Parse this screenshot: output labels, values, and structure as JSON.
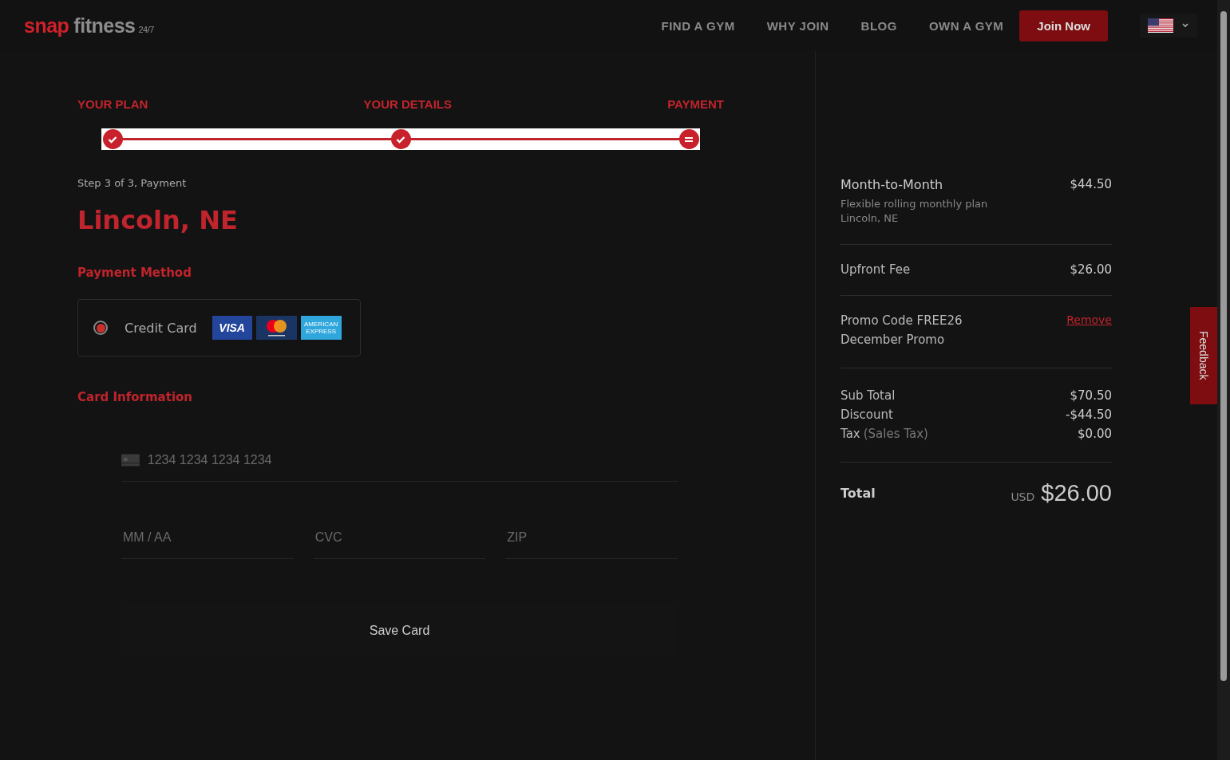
{
  "header": {
    "logo": {
      "word_1": "snap",
      "word_2": "fitness",
      "sup": "24/7"
    },
    "nav": [
      "FIND A GYM",
      "WHY JOIN",
      "BLOG",
      "OWN A GYM"
    ],
    "join_button": "Join Now"
  },
  "steps": [
    {
      "label": "YOUR PLAN",
      "completed": true
    },
    {
      "label": "YOUR DETAILS",
      "completed": true
    },
    {
      "label": "PAYMENT",
      "completed": false
    }
  ],
  "step_caption": "Step 3 of 3, Payment",
  "location": "Lincoln, NE",
  "payment_method": {
    "heading": "Payment Method",
    "option": {
      "label": "Credit Card",
      "selected": true
    },
    "cards": [
      {
        "kind": "visa",
        "text": "VISA"
      },
      {
        "kind": "mastercard"
      },
      {
        "kind": "amex",
        "text": "AMERICAN EXPRESS"
      }
    ]
  },
  "card_information": {
    "heading": "Card Information",
    "number_placeholder": "1234 1234 1234 1234",
    "expiry_placeholder": "MM / AA",
    "cvc_placeholder": "CVC",
    "zip_placeholder": "ZIP",
    "save_button": "Save Card"
  },
  "summary": {
    "plan": {
      "name": "Month-to-Month",
      "price": "$44.50",
      "description": "Flexible rolling monthly plan",
      "location": "Lincoln, NE"
    },
    "upfront": {
      "label": "Upfront Fee",
      "price": "$26.00"
    },
    "promo": {
      "code": "Promo Code FREE26",
      "name": "December Promo",
      "remove": "Remove"
    },
    "lines": [
      {
        "label": "Sub Total",
        "value": "$70.50"
      },
      {
        "label": "Discount",
        "value": "-$44.50"
      },
      {
        "label": "Tax",
        "note": "(Sales Tax)",
        "value": "$0.00"
      }
    ],
    "total": {
      "label": "Total",
      "currency": "USD",
      "amount": "$26.00"
    }
  },
  "feedback_tab": "Feedback"
}
